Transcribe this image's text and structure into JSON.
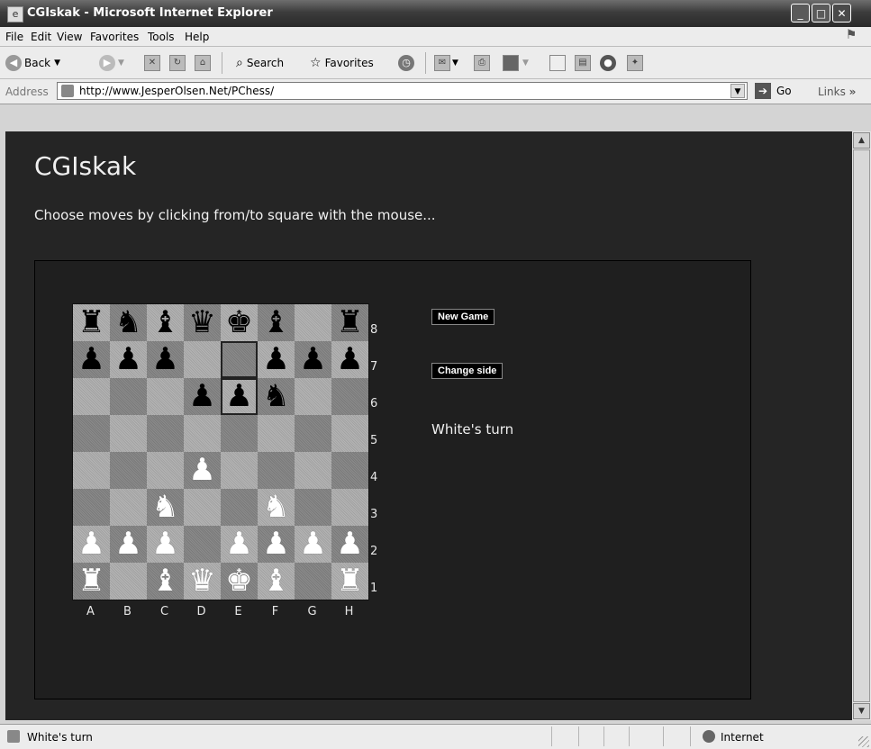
{
  "window": {
    "title": "CGIskak - Microsoft Internet Explorer"
  },
  "menu": [
    "File",
    "Edit",
    "View",
    "Favorites",
    "Tools",
    "Help"
  ],
  "toolbar": {
    "back": "Back",
    "search": "Search",
    "favorites": "Favorites"
  },
  "address": {
    "label": "Address",
    "url": "http://www.JesperOlsen.Net/PChess/",
    "go": "Go",
    "links": "Links"
  },
  "page": {
    "title": "CGIskak",
    "instructions": "Choose moves by clicking from/to square with the mouse...",
    "new_game": "New Game",
    "change_side": "Change side",
    "turn": "White's turn"
  },
  "board": {
    "ranks": [
      "8",
      "7",
      "6",
      "5",
      "4",
      "3",
      "2",
      "1"
    ],
    "files": [
      "A",
      "B",
      "C",
      "D",
      "E",
      "F",
      "G",
      "H"
    ],
    "rows": [
      [
        "r",
        "n",
        "b",
        "q",
        "k",
        "b",
        "",
        "r"
      ],
      [
        "p",
        "p",
        "p",
        "",
        "",
        "p",
        "p",
        "p"
      ],
      [
        "",
        "",
        "",
        "p",
        "p",
        "n",
        "",
        ""
      ],
      [
        "",
        "",
        "",
        "",
        "",
        "",
        "",
        ""
      ],
      [
        "",
        "",
        "",
        "P",
        "",
        "",
        "",
        ""
      ],
      [
        "",
        "",
        "N",
        "",
        "",
        "N",
        "",
        ""
      ],
      [
        "P",
        "P",
        "P",
        "",
        "P",
        "P",
        "P",
        "P"
      ],
      [
        "R",
        "",
        "B",
        "Q",
        "K",
        "B",
        "",
        "R"
      ]
    ],
    "highlighted": [
      "E7",
      "E6"
    ]
  },
  "status": {
    "text": "White's turn",
    "zone": "Internet"
  },
  "icons": {
    "app": "ie-icon",
    "back": "back-arrow-icon",
    "forward": "forward-arrow-icon",
    "stop": "stop-icon",
    "refresh": "refresh-icon",
    "home": "home-icon",
    "search": "search-icon",
    "favorites": "star-icon",
    "history": "history-icon",
    "mail": "mail-icon",
    "print": "print-icon",
    "go": "go-arrow-icon"
  }
}
